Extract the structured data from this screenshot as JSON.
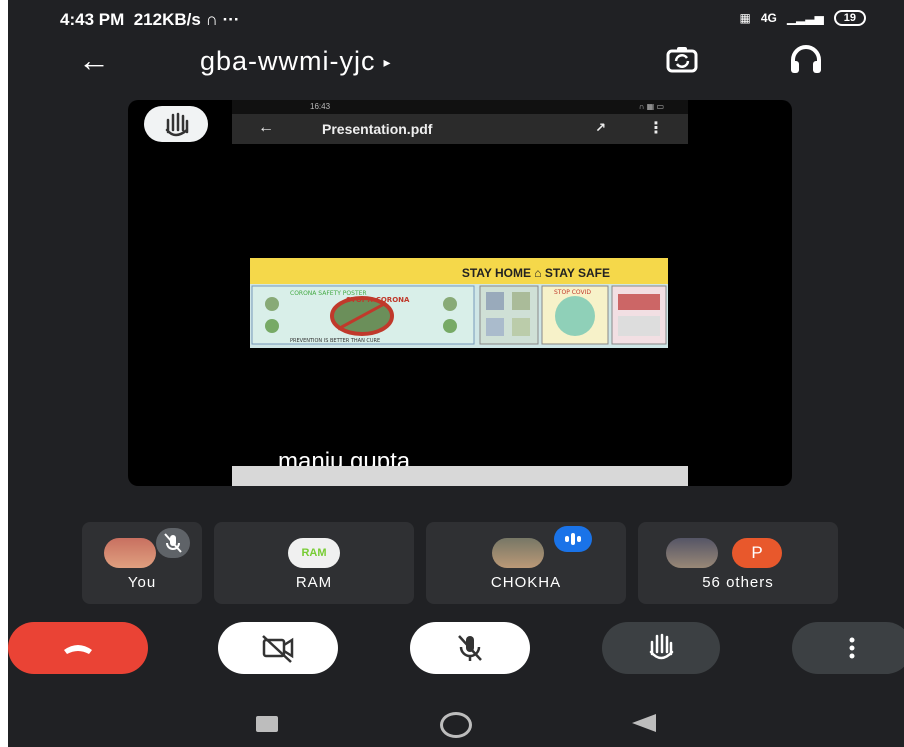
{
  "status_bar": {
    "time": "4:43 PM",
    "speed": "212KB/s",
    "network": "4G",
    "battery": "19"
  },
  "meeting": {
    "code": "gba-wwmi-yjc",
    "code_arrow": "▸"
  },
  "shared_screen": {
    "mini_time": "16:43",
    "document_title": "Presentation.pdf",
    "poster_banner": "STAY HOME ⌂ STAY SAFE",
    "poster_left_title": "CORONA SAFETY POSTER",
    "poster_stop": "STOP!! CORONA",
    "poster_footer": "PREVENTION IS BETTER THAN CURE",
    "poster_right": "STOP COVID",
    "presenter_name": "manju gupta"
  },
  "participants": [
    {
      "name": "You",
      "muted": true
    },
    {
      "name": "RAM",
      "avatar_text": "RAM"
    },
    {
      "name": "CHOKHA",
      "speaking": true
    },
    {
      "name": "56 others",
      "badge": "P"
    }
  ],
  "controls": [
    "end-call",
    "camera-off",
    "mic-off",
    "raise-hand",
    "more-options"
  ],
  "colors": {
    "background": "#202124",
    "end_call": "#ea4335",
    "speaking": "#1a73e8",
    "others_badge": "#e8582c",
    "tile": "#2f3033"
  }
}
